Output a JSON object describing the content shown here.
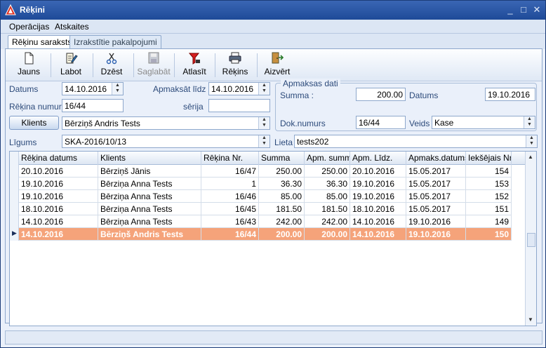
{
  "window": {
    "title": "Rēķini",
    "min": "_",
    "max": "□",
    "close": "✕"
  },
  "menu": [
    "Operācijas",
    "Atskaites"
  ],
  "tabs": [
    {
      "label": "Rēķinu saraksts"
    },
    {
      "label": "Izrakstītie pakalpojumi"
    }
  ],
  "toolbar": {
    "jauns": "Jauns",
    "labot": "Labot",
    "dzest": "Dzēst",
    "saglabat": "Saglabāt",
    "atlasit": "Atlasīt",
    "rekins": "Rēķins",
    "aizvert": "Aizvērt"
  },
  "form": {
    "datums_label": "Datums",
    "datums_value": "14.10.2016",
    "apmaksat_lidz_label": "Apmaksāt līdz :",
    "apmaksat_lidz_value": "14.10.2016",
    "rekina_numurs_label": "Rēķina numurs",
    "rekina_numurs_value": "16/44",
    "serija_label": "sērija",
    "serija_value": "",
    "klients_button": "Klients",
    "klients_value": "Bērziņš Andris Tests",
    "ligums_label": "Līgums",
    "ligums_value": "SKA-2016/10/13",
    "lieta_label": "Lieta",
    "lieta_value": "tests202"
  },
  "payment": {
    "group_title": "Apmaksas dati",
    "summa_label": "Summa :",
    "summa_value": "200.00",
    "datums_label": "Datums",
    "datums_value": "19.10.2016",
    "dok_label": "Dok.numurs",
    "dok_value": "16/44",
    "veids_label": "Veids",
    "veids_value": "Kase"
  },
  "grid": {
    "headers": [
      "Rēķina datums",
      "Klients",
      "Rēķina Nr.",
      "Summa",
      "Apm. summa",
      "Apm. Līdz.",
      "Apmaks.datums",
      "Iekšējais Nr."
    ],
    "rows": [
      [
        "20.10.2016",
        "Bērziņš Jānis",
        "16/47",
        "250.00",
        "250.00",
        "20.10.2016",
        "15.05.2017",
        "154"
      ],
      [
        "19.10.2016",
        "Bērziņa Anna Tests",
        "1",
        "36.30",
        "36.30",
        "19.10.2016",
        "15.05.2017",
        "153"
      ],
      [
        "19.10.2016",
        "Bērziņa Anna Tests",
        "16/46",
        "85.00",
        "85.00",
        "19.10.2016",
        "15.05.2017",
        "152"
      ],
      [
        "18.10.2016",
        "Bērziņa Anna Tests",
        "16/45",
        "181.50",
        "181.50",
        "18.10.2016",
        "15.05.2017",
        "151"
      ],
      [
        "14.10.2016",
        "Bērziņa Anna Tests",
        "16/43",
        "242.00",
        "242.00",
        "14.10.2016",
        "19.10.2016",
        "149"
      ],
      [
        "14.10.2016",
        "Bērziņš Andris Tests",
        "16/44",
        "200.00",
        "200.00",
        "14.10.2016",
        "19.10.2016",
        "150"
      ]
    ],
    "selected_row": 5,
    "selected_color": "#f5a37a"
  }
}
